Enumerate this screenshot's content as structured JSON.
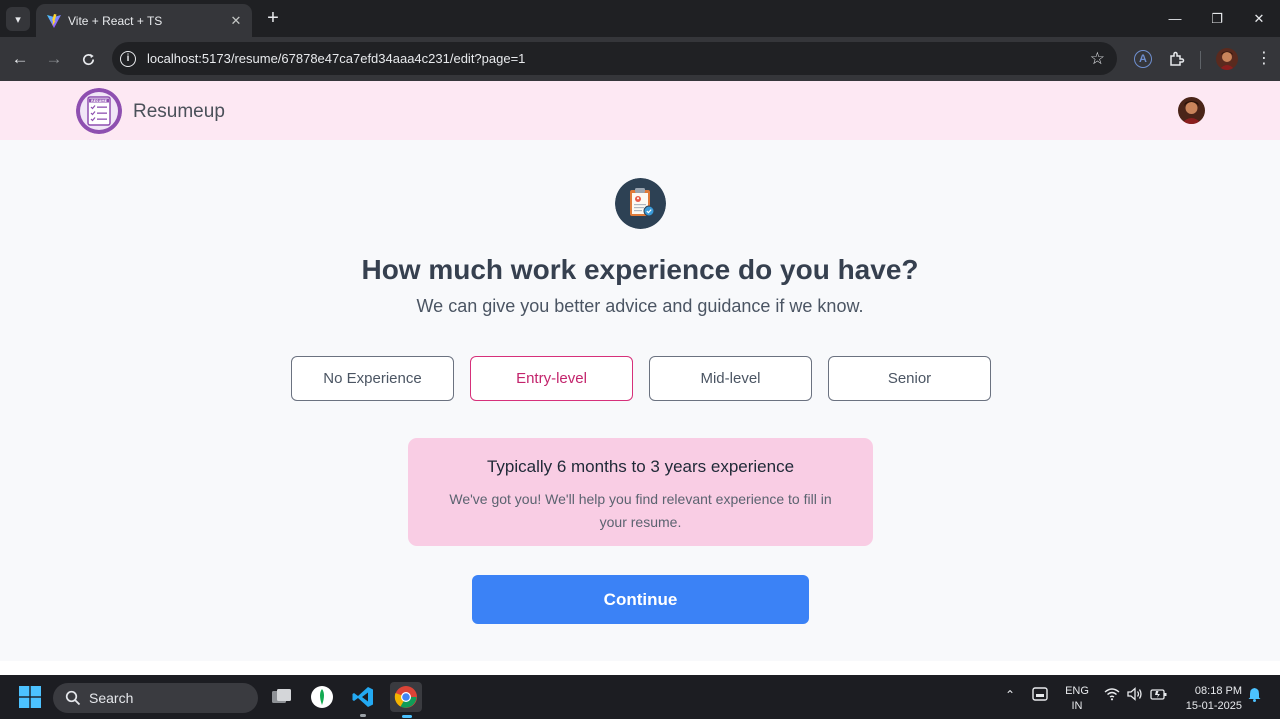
{
  "browser": {
    "tab_title": "Vite + React + TS",
    "tab_close": "✕",
    "new_tab": "+",
    "url": "localhost:5173/resume/67878e47ca7efd34aaa4c231/edit?page=1",
    "window_minimize": "—",
    "window_restore": "❐",
    "window_close": "✕",
    "ext_letter": "A",
    "menu": "⋮"
  },
  "header": {
    "brand": "Resumeup",
    "logo_text": "RESUME"
  },
  "main": {
    "heading": "How much work experience do you have?",
    "subheading": "We can give you better advice and guidance if we know.",
    "options": [
      "No Experience",
      "Entry-level",
      "Mid-level",
      "Senior"
    ],
    "selected_option": "Entry-level",
    "info_title": "Typically 6 months to 3 years experience",
    "info_body": "We've got you! We'll help you find relevant experience to fill in your resume.",
    "continue_label": "Continue"
  },
  "taskbar": {
    "search_label": "Search",
    "lang_line1": "ENG",
    "lang_line2": "IN",
    "time": "08:18 PM",
    "date": "15-01-2025"
  },
  "colors": {
    "accent_pink": "#d6307a",
    "header_bg": "#fde8f3",
    "info_bg": "#f9cde4",
    "primary_button": "#3b82f6"
  }
}
